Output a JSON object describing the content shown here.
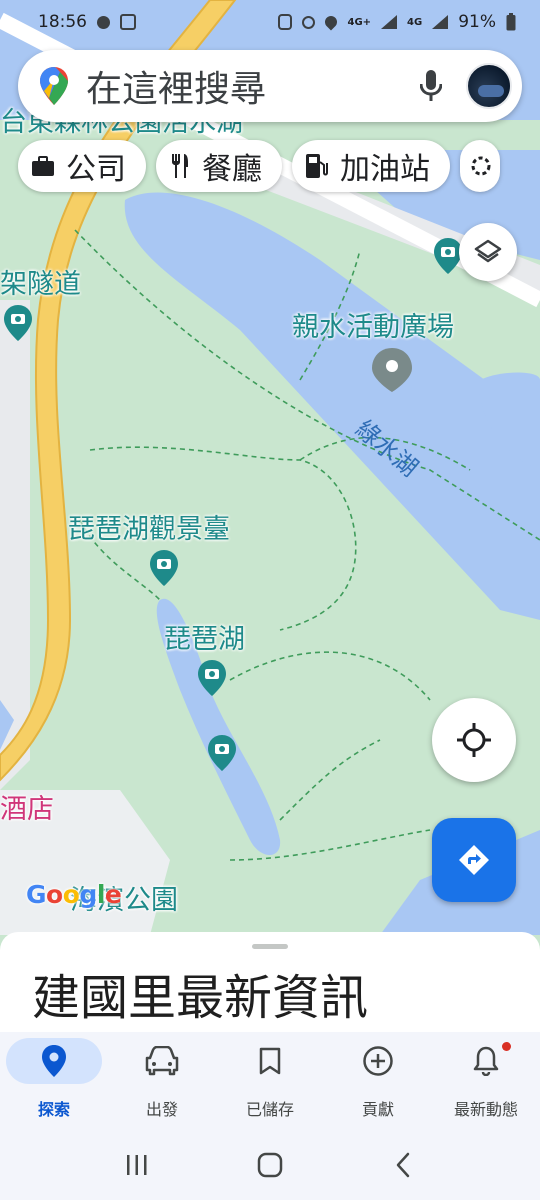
{
  "status_bar": {
    "time": "18:56",
    "network_1": "4G+",
    "network_2": "4G",
    "battery": "91%"
  },
  "search": {
    "placeholder": "在這裡搜尋"
  },
  "chips": [
    {
      "label": "公司",
      "icon": "briefcase-icon"
    },
    {
      "label": "餐廳",
      "icon": "restaurant-icon"
    },
    {
      "label": "加油站",
      "icon": "gas-station-icon"
    },
    {
      "label": "",
      "icon": "more-category-icon"
    }
  ],
  "map": {
    "labels": {
      "top_partial": "台東森林公園活水湖",
      "tunnel": "架隧道",
      "plaza": "親水活動廣場",
      "lake": "綠水湖",
      "viewpoint": "琵琶湖觀景臺",
      "pipa_lake": "琵琶湖",
      "hotel": "酒店",
      "park": "海濱公園"
    },
    "colors": {
      "water": "#a9c7f3",
      "park": "#c9e6cf",
      "road": "#f6cf65",
      "label_teal": "#1e8a8a",
      "hotel_pink": "#d0367a"
    }
  },
  "google_logo": {
    "text": "Google"
  },
  "bottom_sheet": {
    "title": "建國里最新資訊"
  },
  "bottom_nav": [
    {
      "label": "探索",
      "icon": "location-pin-icon",
      "active": true
    },
    {
      "label": "出發",
      "icon": "car-icon",
      "active": false
    },
    {
      "label": "已儲存",
      "icon": "bookmark-icon",
      "active": false
    },
    {
      "label": "貢獻",
      "icon": "add-circle-icon",
      "active": false
    },
    {
      "label": "最新動態",
      "icon": "bell-icon",
      "active": false
    }
  ],
  "accent_color": "#1a73e8"
}
